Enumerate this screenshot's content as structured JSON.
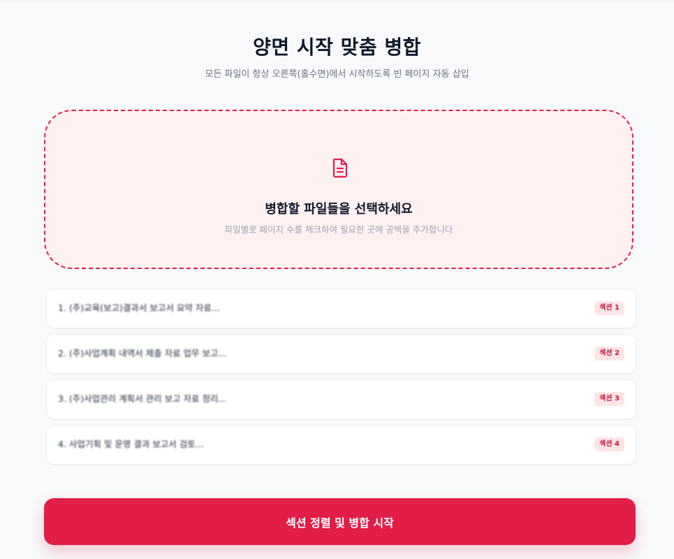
{
  "header": {
    "title": "양면 시작 맞춤 병합",
    "subtitle": "모든 파일이 항상 오른쪽(홀수면)에서 시작하도록 빈 페이지 자동 삽입"
  },
  "dropzone": {
    "icon": "file-text-icon",
    "title": "병합할 파일들을 선택하세요",
    "subtitle": "파일별로 페이지 수를 체크하여 필요한 곳에 공백을 추가합니다"
  },
  "files": [
    {
      "name": "1. (주)교육(보고)결과서 보고서 요약 자료...",
      "section": "섹션 1"
    },
    {
      "name": "2. (주)사업계획 내역서 제출 자료 업무 보고...",
      "section": "섹션 2"
    },
    {
      "name": "3. (주)사업관리 계획서 관리 보고 자료 정리...",
      "section": "섹션 3"
    },
    {
      "name": "4. 사업기획 및 운영 결과 보고서 검토...",
      "section": "섹션 4"
    }
  ],
  "actions": {
    "start_label": "섹션 정렬 및 병합 시작"
  },
  "colors": {
    "accent": "#e11d48",
    "dropzone_bg": "#fff1f2",
    "badge_bg": "#ffe4e6",
    "badge_text": "#be123c"
  }
}
